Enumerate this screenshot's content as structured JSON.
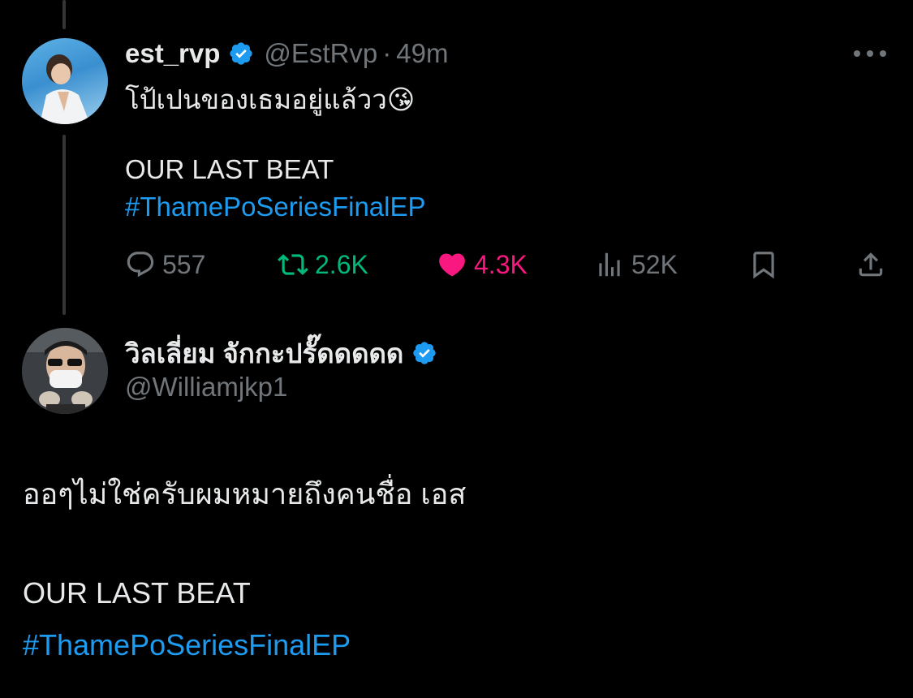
{
  "tweet1": {
    "display_name": "est_rvp",
    "handle": "@EstRvp",
    "separator": "·",
    "time": "49m",
    "text": "โป้เปนของเธมอยู่แล้วว😘",
    "line2": "OUR LAST BEAT",
    "hashtag": "#ThamePoSeriesFinalEP",
    "stats": {
      "replies": "557",
      "retweets": "2.6K",
      "likes": "4.3K",
      "views": "52K"
    },
    "colors": {
      "retweet": "#00ba7c",
      "like": "#f91880",
      "muted": "#71767b",
      "link": "#1d9bf0"
    }
  },
  "tweet2": {
    "display_name": "วิลเลี่ยม จักกะปรั๊ดดดดด",
    "handle": "@Williamjkp1",
    "text": "ออๆไม่ใช่ครับผมหมายถึงคนชื่อ เอส",
    "line2": "OUR LAST BEAT",
    "hashtag": "#ThamePoSeriesFinalEP"
  },
  "icons": {
    "verified": "verified-badge-icon",
    "more": "more-horizontal-icon",
    "reply": "reply-icon",
    "retweet": "retweet-icon",
    "like": "heart-icon",
    "views": "views-icon",
    "bookmark": "bookmark-icon",
    "share": "share-icon"
  }
}
